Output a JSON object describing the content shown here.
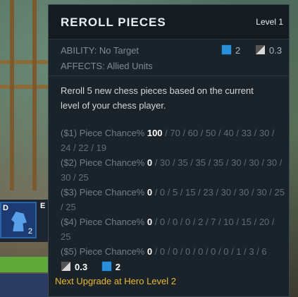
{
  "ability": {
    "title": "REROLL PIECES",
    "level": "Level 1",
    "ability_type": "ABILITY: No Target",
    "affects": "AFFECTS: Allied Units",
    "mana_cost": "2",
    "cooldown": "0.3",
    "description": "Reroll 5 new chess pieces based on the current level of your chess player.",
    "chances": [
      {
        "label": "($1) Piece Chance% ",
        "current": "100",
        "rest": " / 70 / 60 / 50 / 40 / 33 / 30 / 24 / 22 / 19"
      },
      {
        "label": "($2) Piece Chance% ",
        "current": "0",
        "rest": " / 30 / 35 / 35 / 35 / 30 / 30 / 30 / 30 / 25"
      },
      {
        "label": "($3) Piece Chance% ",
        "current": "0",
        "rest": " / 0 / 5 / 15 / 23 / 30 / 30 / 30 / 25 / 25"
      },
      {
        "label": "($4) Piece Chance% ",
        "current": "0",
        "rest": " / 0 / 0 / 0 / 2 / 7 / 10 / 15 / 20 / 25"
      },
      {
        "label": "($5) Piece Chance% ",
        "current": "0",
        "rest": " / 0 / 0 / 0 / 0 / 0 / 0 / 1 / 3 / 6"
      }
    ],
    "bottom_cooldown": "0.3",
    "bottom_mana": "2",
    "upgrade_note": "Next Upgrade at Hero Level 2"
  },
  "bench": {
    "slot_d_letter": "D",
    "slot_d_count": "2",
    "slot_e_letter": "E"
  },
  "colors": {
    "tooltip_bg": "#1b232a",
    "upgrade_text": "#e8b830",
    "mana": "#2a8fd6"
  }
}
